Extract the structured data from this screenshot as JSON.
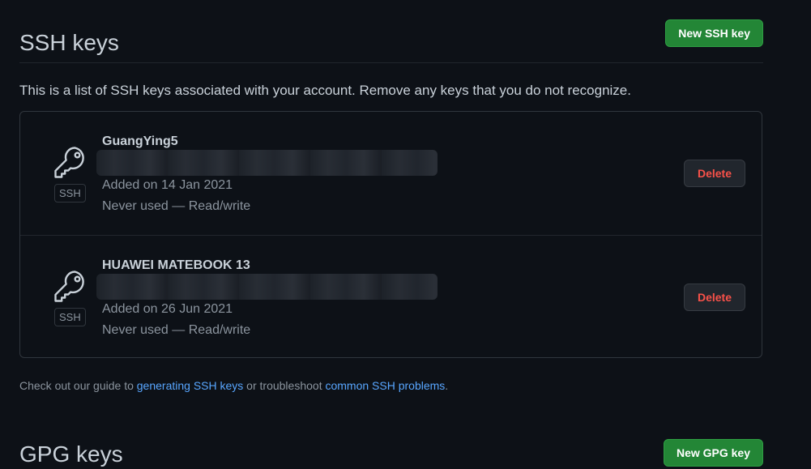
{
  "ssh_section": {
    "title": "SSH keys",
    "new_button": "New SSH key",
    "description": "This is a list of SSH keys associated with your account. Remove any keys that you do not recognize.",
    "keys": [
      {
        "name": "GuangYing5",
        "badge": "SSH",
        "added": "Added on 14 Jan 2021",
        "usage": "Never used — Read/write",
        "delete_label": "Delete"
      },
      {
        "name": "HUAWEI MATEBOOK 13",
        "badge": "SSH",
        "added": "Added on 26 Jun 2021",
        "usage": "Never used — Read/write",
        "delete_label": "Delete"
      }
    ],
    "guide": {
      "prefix": "Check out our guide to ",
      "link1": "generating SSH keys",
      "middle": " or troubleshoot ",
      "link2": "common SSH problems",
      "suffix": "."
    }
  },
  "gpg_section": {
    "title": "GPG keys",
    "new_button": "New GPG key"
  },
  "colors": {
    "background": "#0d1117",
    "primary_button": "#238636",
    "danger_text": "#f85149",
    "link": "#58a6ff"
  },
  "icons": [
    "key-icon"
  ]
}
